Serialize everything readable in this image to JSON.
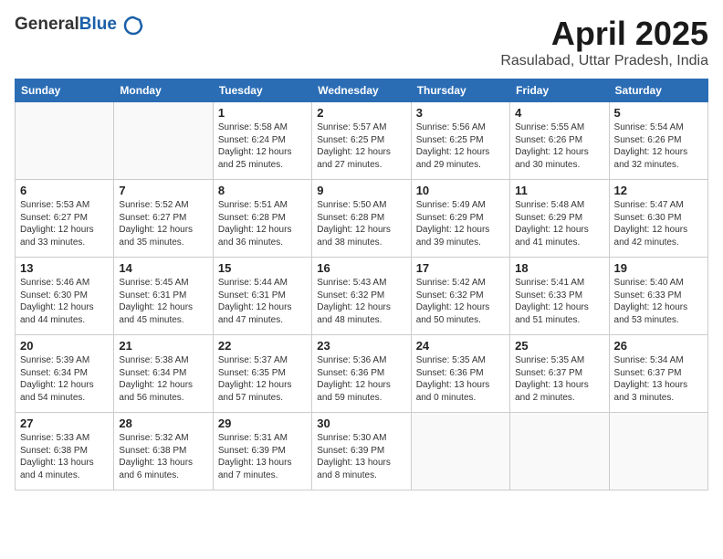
{
  "header": {
    "logo_general": "General",
    "logo_blue": "Blue",
    "month_title": "April 2025",
    "location": "Rasulabad, Uttar Pradesh, India"
  },
  "calendar": {
    "days_of_week": [
      "Sunday",
      "Monday",
      "Tuesday",
      "Wednesday",
      "Thursday",
      "Friday",
      "Saturday"
    ],
    "weeks": [
      [
        {
          "day": "",
          "info": ""
        },
        {
          "day": "",
          "info": ""
        },
        {
          "day": "1",
          "info": "Sunrise: 5:58 AM\nSunset: 6:24 PM\nDaylight: 12 hours and 25 minutes."
        },
        {
          "day": "2",
          "info": "Sunrise: 5:57 AM\nSunset: 6:25 PM\nDaylight: 12 hours and 27 minutes."
        },
        {
          "day": "3",
          "info": "Sunrise: 5:56 AM\nSunset: 6:25 PM\nDaylight: 12 hours and 29 minutes."
        },
        {
          "day": "4",
          "info": "Sunrise: 5:55 AM\nSunset: 6:26 PM\nDaylight: 12 hours and 30 minutes."
        },
        {
          "day": "5",
          "info": "Sunrise: 5:54 AM\nSunset: 6:26 PM\nDaylight: 12 hours and 32 minutes."
        }
      ],
      [
        {
          "day": "6",
          "info": "Sunrise: 5:53 AM\nSunset: 6:27 PM\nDaylight: 12 hours and 33 minutes."
        },
        {
          "day": "7",
          "info": "Sunrise: 5:52 AM\nSunset: 6:27 PM\nDaylight: 12 hours and 35 minutes."
        },
        {
          "day": "8",
          "info": "Sunrise: 5:51 AM\nSunset: 6:28 PM\nDaylight: 12 hours and 36 minutes."
        },
        {
          "day": "9",
          "info": "Sunrise: 5:50 AM\nSunset: 6:28 PM\nDaylight: 12 hours and 38 minutes."
        },
        {
          "day": "10",
          "info": "Sunrise: 5:49 AM\nSunset: 6:29 PM\nDaylight: 12 hours and 39 minutes."
        },
        {
          "day": "11",
          "info": "Sunrise: 5:48 AM\nSunset: 6:29 PM\nDaylight: 12 hours and 41 minutes."
        },
        {
          "day": "12",
          "info": "Sunrise: 5:47 AM\nSunset: 6:30 PM\nDaylight: 12 hours and 42 minutes."
        }
      ],
      [
        {
          "day": "13",
          "info": "Sunrise: 5:46 AM\nSunset: 6:30 PM\nDaylight: 12 hours and 44 minutes."
        },
        {
          "day": "14",
          "info": "Sunrise: 5:45 AM\nSunset: 6:31 PM\nDaylight: 12 hours and 45 minutes."
        },
        {
          "day": "15",
          "info": "Sunrise: 5:44 AM\nSunset: 6:31 PM\nDaylight: 12 hours and 47 minutes."
        },
        {
          "day": "16",
          "info": "Sunrise: 5:43 AM\nSunset: 6:32 PM\nDaylight: 12 hours and 48 minutes."
        },
        {
          "day": "17",
          "info": "Sunrise: 5:42 AM\nSunset: 6:32 PM\nDaylight: 12 hours and 50 minutes."
        },
        {
          "day": "18",
          "info": "Sunrise: 5:41 AM\nSunset: 6:33 PM\nDaylight: 12 hours and 51 minutes."
        },
        {
          "day": "19",
          "info": "Sunrise: 5:40 AM\nSunset: 6:33 PM\nDaylight: 12 hours and 53 minutes."
        }
      ],
      [
        {
          "day": "20",
          "info": "Sunrise: 5:39 AM\nSunset: 6:34 PM\nDaylight: 12 hours and 54 minutes."
        },
        {
          "day": "21",
          "info": "Sunrise: 5:38 AM\nSunset: 6:34 PM\nDaylight: 12 hours and 56 minutes."
        },
        {
          "day": "22",
          "info": "Sunrise: 5:37 AM\nSunset: 6:35 PM\nDaylight: 12 hours and 57 minutes."
        },
        {
          "day": "23",
          "info": "Sunrise: 5:36 AM\nSunset: 6:36 PM\nDaylight: 12 hours and 59 minutes."
        },
        {
          "day": "24",
          "info": "Sunrise: 5:35 AM\nSunset: 6:36 PM\nDaylight: 13 hours and 0 minutes."
        },
        {
          "day": "25",
          "info": "Sunrise: 5:35 AM\nSunset: 6:37 PM\nDaylight: 13 hours and 2 minutes."
        },
        {
          "day": "26",
          "info": "Sunrise: 5:34 AM\nSunset: 6:37 PM\nDaylight: 13 hours and 3 minutes."
        }
      ],
      [
        {
          "day": "27",
          "info": "Sunrise: 5:33 AM\nSunset: 6:38 PM\nDaylight: 13 hours and 4 minutes."
        },
        {
          "day": "28",
          "info": "Sunrise: 5:32 AM\nSunset: 6:38 PM\nDaylight: 13 hours and 6 minutes."
        },
        {
          "day": "29",
          "info": "Sunrise: 5:31 AM\nSunset: 6:39 PM\nDaylight: 13 hours and 7 minutes."
        },
        {
          "day": "30",
          "info": "Sunrise: 5:30 AM\nSunset: 6:39 PM\nDaylight: 13 hours and 8 minutes."
        },
        {
          "day": "",
          "info": ""
        },
        {
          "day": "",
          "info": ""
        },
        {
          "day": "",
          "info": ""
        }
      ]
    ]
  }
}
